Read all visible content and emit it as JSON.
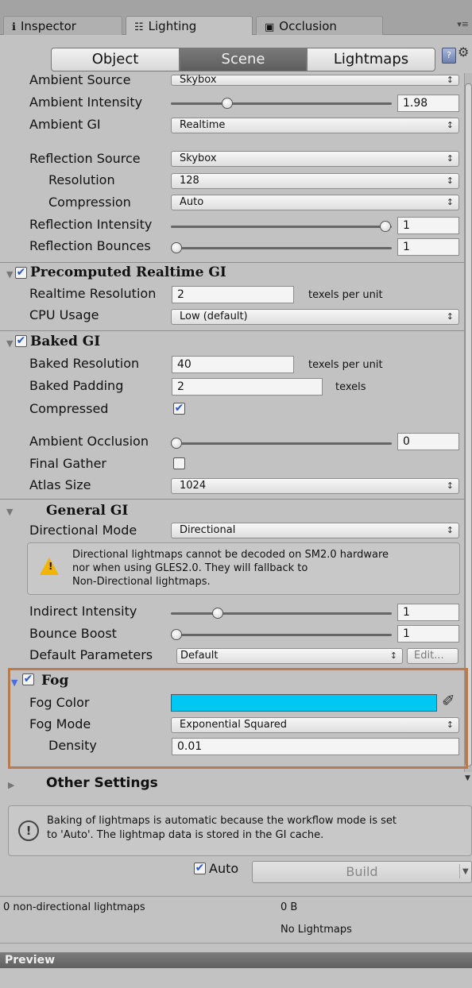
{
  "tabs": [
    {
      "label": "Inspector",
      "icon": "info-icon"
    },
    {
      "label": "Lighting",
      "icon": "lighting-icon"
    },
    {
      "label": "Occlusion",
      "icon": "occlusion-icon"
    }
  ],
  "segments": [
    {
      "label": "Object",
      "active": false
    },
    {
      "label": "Scene",
      "active": true
    },
    {
      "label": "Lightmaps",
      "active": false
    }
  ],
  "environment": {
    "ambient_source_label": "Ambient Source",
    "ambient_source_value": "Skybox",
    "ambient_intensity_label": "Ambient Intensity",
    "ambient_intensity_value": "1.98",
    "ambient_intensity_fraction": 0.25,
    "ambient_gi_label": "Ambient GI",
    "ambient_gi_value": "Realtime",
    "reflection_source_label": "Reflection Source",
    "reflection_source_value": "Skybox",
    "resolution_label": "Resolution",
    "resolution_value": "128",
    "compression_label": "Compression",
    "compression_value": "Auto",
    "reflection_intensity_label": "Reflection Intensity",
    "reflection_intensity_value": "1",
    "reflection_bounces_label": "Reflection Bounces",
    "reflection_bounces_value": "1"
  },
  "precomputed": {
    "title": "Precomputed Realtime GI",
    "enabled": true,
    "realtime_resolution_label": "Realtime Resolution",
    "realtime_resolution_value": "2",
    "realtime_resolution_unit": "texels per unit",
    "cpu_usage_label": "CPU Usage",
    "cpu_usage_value": "Low (default)"
  },
  "baked": {
    "title": "Baked GI",
    "enabled": true,
    "baked_resolution_label": "Baked Resolution",
    "baked_resolution_value": "40",
    "baked_resolution_unit": "texels per unit",
    "baked_padding_label": "Baked Padding",
    "baked_padding_value": "2",
    "baked_padding_unit": "texels",
    "compressed_label": "Compressed",
    "compressed_checked": true,
    "ambient_occlusion_label": "Ambient Occlusion",
    "ambient_occlusion_value": "0",
    "final_gather_label": "Final Gather",
    "final_gather_checked": false,
    "atlas_size_label": "Atlas Size",
    "atlas_size_value": "1024"
  },
  "general": {
    "title": "General GI",
    "directional_mode_label": "Directional Mode",
    "directional_mode_value": "Directional",
    "warning_text": "Directional lightmaps cannot be decoded on SM2.0 hardware\nnor when using GLES2.0. They will fallback to\nNon-Directional lightmaps.",
    "indirect_intensity_label": "Indirect Intensity",
    "indirect_intensity_value": "1",
    "bounce_boost_label": "Bounce Boost",
    "bounce_boost_value": "1",
    "default_parameters_label": "Default Parameters",
    "default_parameters_value": "Default",
    "edit_label": "Edit..."
  },
  "fog": {
    "title": "Fog",
    "enabled": true,
    "fog_color_label": "Fog Color",
    "fog_color_value": "#00c8f5",
    "fog_mode_label": "Fog Mode",
    "fog_mode_value": "Exponential Squared",
    "density_label": "Density",
    "density_value": "0.01",
    "highlight_color": "#b97a4d"
  },
  "other_settings": {
    "title": "Other Settings"
  },
  "info": {
    "text": "Baking of lightmaps is automatic because the workflow mode is set\nto 'Auto'. The lightmap data is stored in the GI cache."
  },
  "build": {
    "auto_label": "Auto",
    "auto_checked": true,
    "build_label": "Build"
  },
  "stats": {
    "count_label": "0 non-directional lightmaps",
    "size_label": "0 B",
    "status_label": "No Lightmaps"
  },
  "preview": {
    "title": "Preview"
  }
}
